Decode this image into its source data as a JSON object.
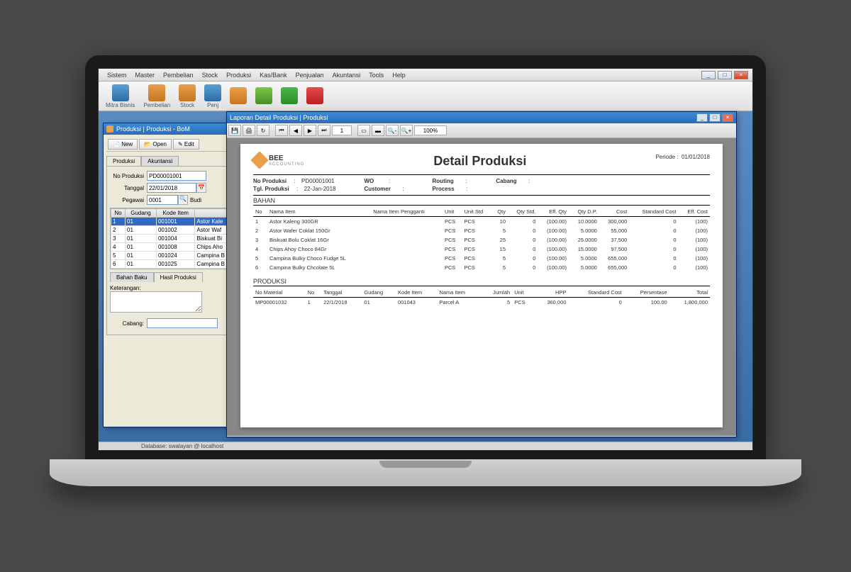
{
  "menubar": [
    "Sistem",
    "Master",
    "Pembelian",
    "Stock",
    "Produksi",
    "Kas/Bank",
    "Penjualan",
    "Akuntansi",
    "Tools",
    "Help"
  ],
  "toolbar": [
    {
      "label": "Mitra Bisnis"
    },
    {
      "label": "Pembelian"
    },
    {
      "label": "Stock"
    },
    {
      "label": "Penj"
    },
    {
      "label": ""
    },
    {
      "label": ""
    },
    {
      "label": ""
    },
    {
      "label": ""
    }
  ],
  "statusbar": "Database: swalayan @ localhost",
  "bom": {
    "title": "Produksi | Produksi - BoM",
    "btn_new": "New",
    "btn_open": "Open",
    "btn_edit": "Edit",
    "tab1": "Produksi",
    "tab2": "Akuntansi",
    "fld_no": "No Produksi",
    "val_no": "PD00001001",
    "fld_tgl": "Tanggal",
    "val_tgl": "22/01/2018",
    "fld_peg": "Pegawai",
    "val_peg": "0001",
    "val_pegname": "Budi",
    "cols": [
      "No",
      "Gudang",
      "Kode Item",
      ""
    ],
    "rows": [
      [
        "1",
        "01",
        "001001",
        "Astor Kale"
      ],
      [
        "2",
        "01",
        "001002",
        "Astor Waf"
      ],
      [
        "3",
        "01",
        "001004",
        "Biskuat Bi"
      ],
      [
        "4",
        "01",
        "001008",
        "Chips Aho"
      ],
      [
        "5",
        "01",
        "001024",
        "Campina B"
      ],
      [
        "6",
        "01",
        "001025",
        "Campina B"
      ]
    ],
    "btab1": "Bahan Baku",
    "btab2": "Hasil Produksi",
    "lbl_ket": "Keterangan:",
    "lbl_cabang": "Cabang:"
  },
  "report": {
    "title": "Laporan Detail Produksi | Produksi",
    "page": "1",
    "zoom": "100%",
    "brand": "BEE",
    "brand_sub": "ACCOUNTING",
    "rpt_title": "Detail Produksi",
    "periode_lbl": "Periode :",
    "periode_val": "01/01/2018",
    "info": {
      "no_lbl": "No Produksi",
      "no_val": "PD00001001",
      "tgl_lbl": "Tgl. Produksi",
      "tgl_val": "22-Jan-2018",
      "wo_lbl": "WO",
      "wo_val": ":",
      "cust_lbl": "Customer",
      "cust_val": ":",
      "rout_lbl": "Routing",
      "rout_val": ":",
      "proc_lbl": "Process",
      "proc_val": ":",
      "cab_lbl": "Cabang",
      "cab_val": ":"
    },
    "bahan_title": "BAHAN",
    "bahan_cols": [
      "No",
      "Nama Item",
      "Nama Item Pengganti",
      "Unit",
      "Unit Std",
      "Qty",
      "Qty Std.",
      "Eff. Qty",
      "Qty D.P.",
      "Cost",
      "Standard Cost",
      "Eff. Cost"
    ],
    "bahan": [
      [
        "1",
        "Astor Kaleng 300GR",
        "",
        "PCS",
        "PCS",
        "10",
        "0",
        "(100.00)",
        "10.0000",
        "300,000",
        "0",
        "(100)"
      ],
      [
        "2",
        "Astor Wafer Coklat 150Gr",
        "",
        "PCS",
        "PCS",
        "5",
        "0",
        "(100.00)",
        "5.0000",
        "55,000",
        "0",
        "(100)"
      ],
      [
        "3",
        "Biskuat Bolu Coklat 16Gr",
        "",
        "PCS",
        "PCS",
        "25",
        "0",
        "(100.00)",
        "25.0000",
        "37,500",
        "0",
        "(100)"
      ],
      [
        "4",
        "Chips Ahoy Choco 84Gr",
        "",
        "PCS",
        "PCS",
        "15",
        "0",
        "(100.00)",
        "15.0000",
        "97,500",
        "0",
        "(100)"
      ],
      [
        "5",
        "Campina Bulky Choco Fudge 5L",
        "",
        "PCS",
        "PCS",
        "5",
        "0",
        "(100.00)",
        "5.0000",
        "655,000",
        "0",
        "(100)"
      ],
      [
        "6",
        "Campina Bulky Chcolate 5L",
        "",
        "PCS",
        "PCS",
        "5",
        "0",
        "(100.00)",
        "5.0000",
        "655,000",
        "0",
        "(100)"
      ]
    ],
    "prod_title": "PRODUKSI",
    "prod_cols": [
      "No Material",
      "No",
      "Tanggal",
      "Gudang",
      "Kode Item",
      "Nama Item",
      "Jumlah",
      "Unit",
      "HPP",
      "Standard Cost",
      "Persentase",
      "Total"
    ],
    "prod": [
      [
        "MP00001032",
        "1",
        "22/1/2018",
        "01",
        "001043",
        "Parcel A",
        "5",
        "PCS",
        "360,000",
        "0",
        "100.00",
        "1,800,000"
      ]
    ]
  }
}
